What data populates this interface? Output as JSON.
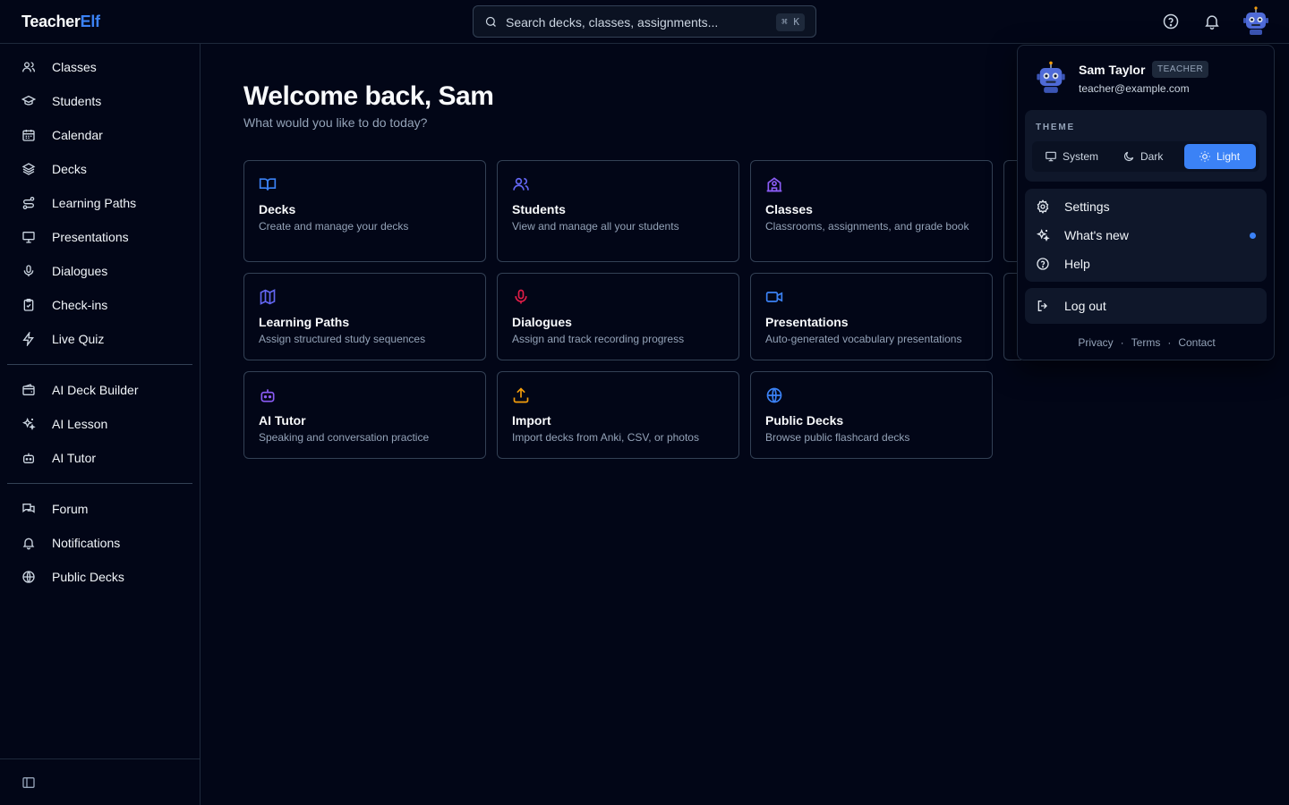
{
  "brand": {
    "part1": "Teacher",
    "part2": "Elf"
  },
  "search": {
    "placeholder": "Search decks, classes, assignments...",
    "shortcut": "⌘ K"
  },
  "sidebar": {
    "group1": [
      {
        "label": "Classes",
        "icon": "users-icon"
      },
      {
        "label": "Students",
        "icon": "graduation-cap-icon"
      },
      {
        "label": "Calendar",
        "icon": "calendar-icon"
      },
      {
        "label": "Decks",
        "icon": "layers-icon"
      },
      {
        "label": "Learning Paths",
        "icon": "route-icon"
      },
      {
        "label": "Presentations",
        "icon": "presentation-icon"
      },
      {
        "label": "Dialogues",
        "icon": "microphone-icon"
      },
      {
        "label": "Check-ins",
        "icon": "clipboard-check-icon"
      },
      {
        "label": "Live Quiz",
        "icon": "lightning-icon"
      }
    ],
    "group2": [
      {
        "label": "AI Deck Builder",
        "icon": "wallet-icon"
      },
      {
        "label": "AI Lesson",
        "icon": "sparkles-icon"
      },
      {
        "label": "AI Tutor",
        "icon": "robot-icon"
      }
    ],
    "group3": [
      {
        "label": "Forum",
        "icon": "chat-icon"
      },
      {
        "label": "Notifications",
        "icon": "bell-icon"
      },
      {
        "label": "Public Decks",
        "icon": "globe-icon"
      }
    ]
  },
  "main": {
    "welcome": "Welcome back, Sam",
    "subtitle": "What would you like to do today?",
    "cards": [
      {
        "title": "Decks",
        "desc": "Create and manage your decks",
        "icon": "book-open-icon",
        "color": "#3b82f6"
      },
      {
        "title": "Students",
        "desc": "View and manage all your students",
        "icon": "users-icon",
        "color": "#6366f1"
      },
      {
        "title": "Classes",
        "desc": "Classrooms, assignments, and grade book",
        "icon": "school-icon",
        "color": "#8b5cf6"
      },
      {
        "title": "Learning Paths",
        "desc": "Assign structured study sequences",
        "icon": "map-icon",
        "color": "#6366f1"
      },
      {
        "title": "Dialogues",
        "desc": "Assign and track recording progress",
        "icon": "microphone-icon",
        "color": "#e11d48"
      },
      {
        "title": "Presentations",
        "desc": "Auto-generated vocabulary presentations",
        "icon": "video-icon",
        "color": "#3b82f6"
      },
      {
        "title": "AI Tutor",
        "desc": "Speaking and conversation practice",
        "icon": "robot-icon",
        "color": "#8b5cf6"
      },
      {
        "title": "Import",
        "desc": "Import decks from Anki, CSV, or photos",
        "icon": "upload-icon",
        "color": "#f59e0b"
      },
      {
        "title": "Public Decks",
        "desc": "Browse public flashcard decks",
        "icon": "globe-icon",
        "color": "#3b82f6"
      }
    ]
  },
  "user_menu": {
    "name": "Sam Taylor",
    "role": "TEACHER",
    "email": "teacher@example.com",
    "theme_label": "THEME",
    "theme_options": [
      "System",
      "Dark",
      "Light"
    ],
    "theme_selected": "Light",
    "items": [
      {
        "label": "Settings",
        "icon": "gear-icon"
      },
      {
        "label": "What's new",
        "icon": "sparkles-icon",
        "unread": true
      },
      {
        "label": "Help",
        "icon": "help-circle-icon"
      }
    ],
    "logout": "Log out",
    "footer": [
      "Privacy",
      "Terms",
      "Contact"
    ],
    "accent": "#3b82f6"
  }
}
